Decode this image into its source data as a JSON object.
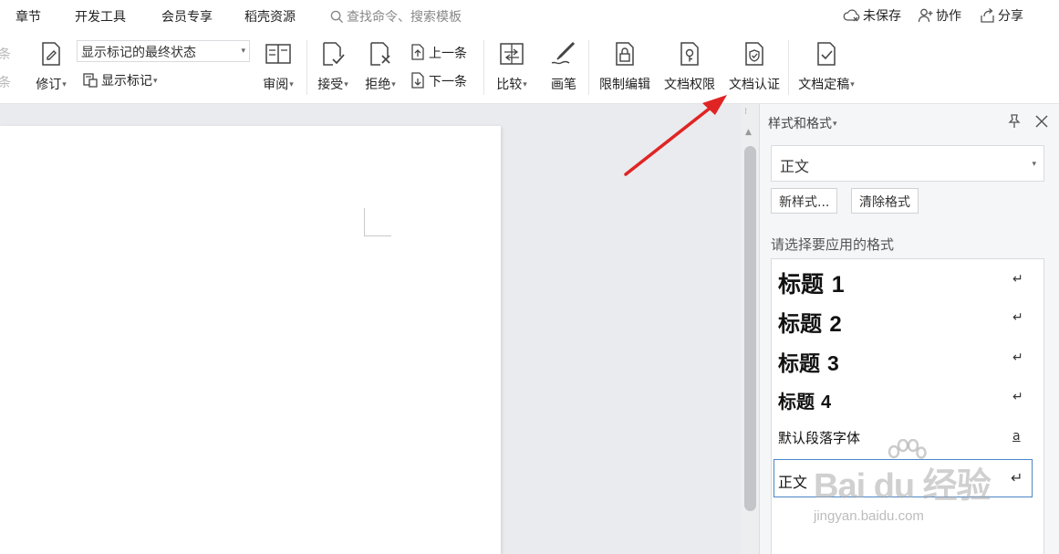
{
  "menubar": {
    "items": [
      "章节",
      "开发工具",
      "会员专享",
      "稻壳资源"
    ],
    "search_placeholder": "查找命令、搜索模板",
    "right": {
      "unsaved": "未保存",
      "collab": "协作",
      "share": "分享"
    }
  },
  "ribbon": {
    "cut_labels": [
      "条",
      "条"
    ],
    "revise": "修订",
    "markup_state_value": "显示标记的最终状态",
    "show_markup": "显示标记",
    "review": "审阅",
    "accept": "接受",
    "reject": "拒绝",
    "prev": "上一条",
    "next": "下一条",
    "compare": "比较",
    "pen": "画笔",
    "restrict_edit": "限制编辑",
    "doc_permission": "文档权限",
    "doc_auth": "文档认证",
    "doc_finalize": "文档定稿"
  },
  "panel": {
    "title": "样式和格式",
    "current_style": "正文",
    "new_style": "新样式...",
    "clear_format": "清除格式",
    "prompt": "请选择要应用的格式",
    "formats": [
      {
        "text": "标题",
        "num": "1",
        "mark": "↵"
      },
      {
        "text": "标题",
        "num": "2",
        "mark": "↵"
      },
      {
        "text": "标题",
        "num": "3",
        "mark": "↵"
      },
      {
        "text": "标题",
        "num": "4",
        "mark": "↵"
      },
      {
        "text": "默认段落字体",
        "num": "",
        "mark": "a"
      },
      {
        "text": "正文",
        "num": "",
        "mark": "↵"
      }
    ]
  },
  "watermark": {
    "logo": "Bai du 经验",
    "sub": "jingyan.baidu.com"
  },
  "colors": {
    "accent": "#4a86c9",
    "annotation_arrow": "#e02424"
  }
}
